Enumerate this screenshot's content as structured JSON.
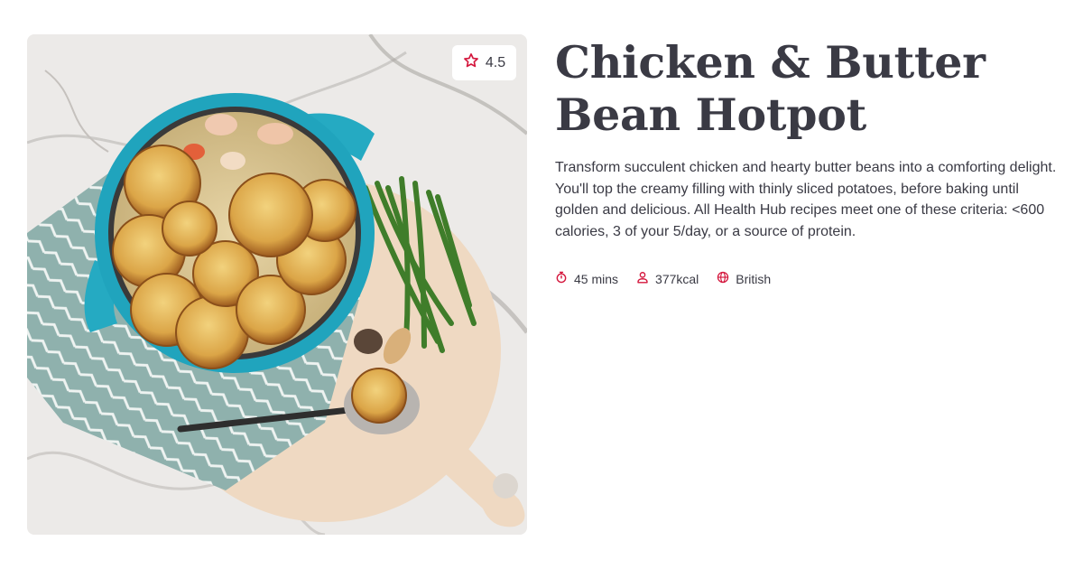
{
  "recipe": {
    "title": "Chicken & Butter Bean Hotpot",
    "description": "Transform succulent chicken and hearty butter beans into a comforting delight. You'll top the creamy filling with thinly sliced potatoes, before baking until golden and delicious. All Health Hub recipes meet one of these criteria: <600 calories, 3 of your 5/day, or a source of protein.",
    "rating": "4.5",
    "meta": {
      "time": "45 mins",
      "calories": "377kcal",
      "cuisine": "British"
    }
  },
  "icons": {
    "rating": "star-icon",
    "time": "stopwatch-icon",
    "calories": "person-icon",
    "cuisine": "globe-icon"
  },
  "colors": {
    "accent": "#d4163c",
    "text": "#3a3a44"
  }
}
